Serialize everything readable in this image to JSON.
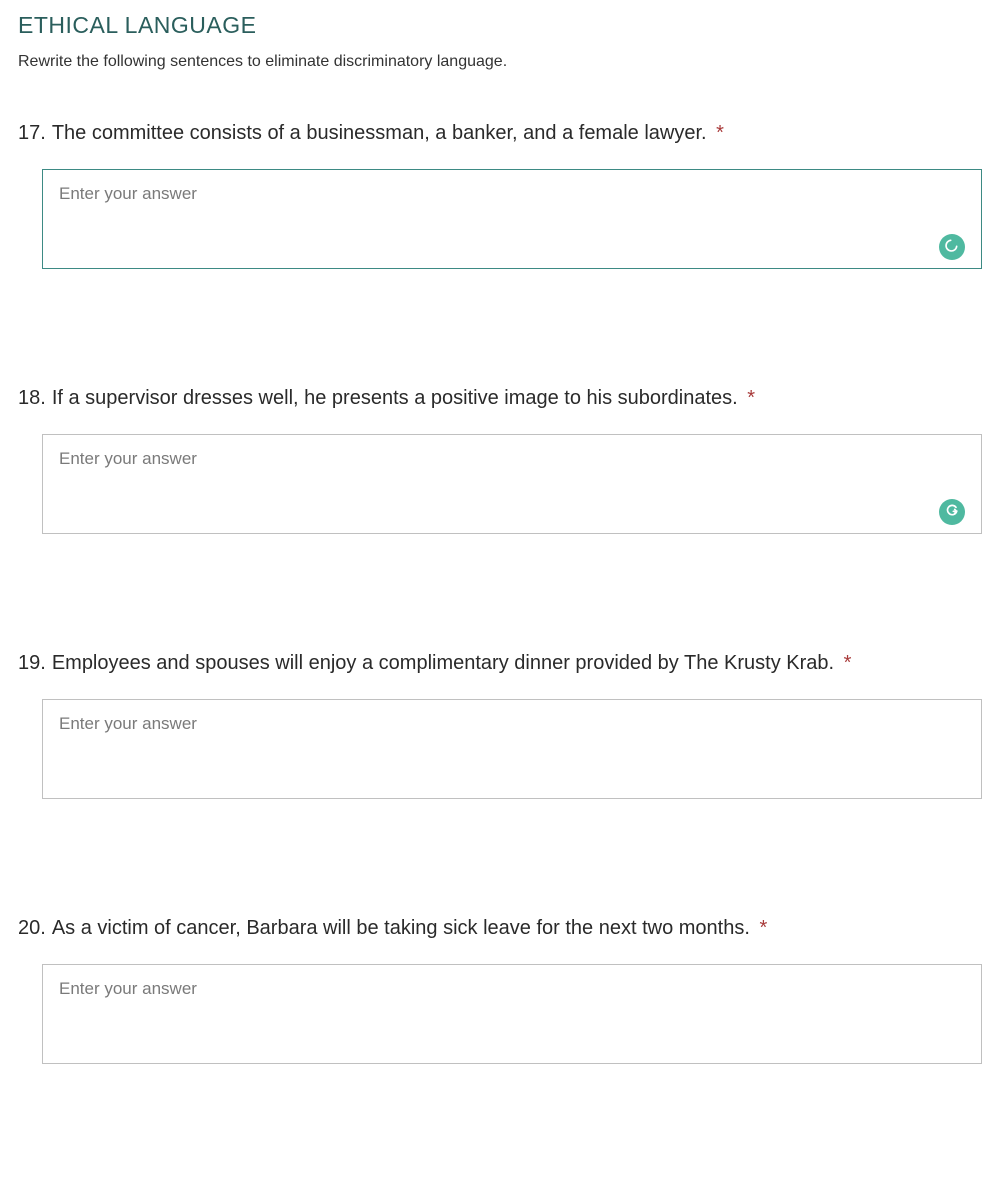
{
  "section": {
    "heading": "ETHICAL LANGUAGE",
    "description": "Rewrite the following sentences to eliminate discriminatory language."
  },
  "questions": [
    {
      "number": "17.",
      "text": "The committee consists of a businessman, a banker, and a female lawyer.",
      "required": "*",
      "placeholder": "Enter your answer",
      "focused": true,
      "badge": "moon"
    },
    {
      "number": "18.",
      "text": "If a supervisor dresses well, he presents a positive image to his subordinates.",
      "required": "*",
      "placeholder": "Enter your answer",
      "focused": false,
      "badge": "g"
    },
    {
      "number": "19.",
      "text": "Employees and spouses will enjoy a complimentary dinner provided by The Krusty Krab. ",
      "required": "*",
      "placeholder": "Enter your answer",
      "focused": false,
      "badge": null
    },
    {
      "number": "20.",
      "text": "As a victim of cancer, Barbara will be taking sick leave for the next two months.",
      "required": "*",
      "placeholder": "Enter your answer",
      "focused": false,
      "badge": null
    }
  ]
}
